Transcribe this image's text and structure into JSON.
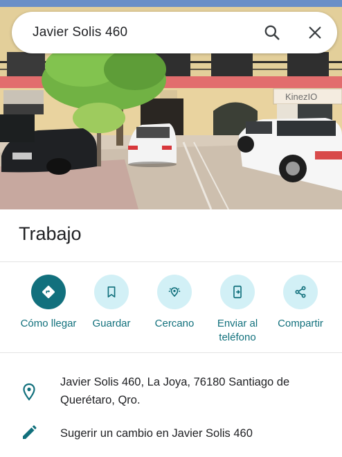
{
  "search": {
    "query": "Javier Solis 460"
  },
  "photo": {
    "sign_text": "KinezIO"
  },
  "place": {
    "title": "Trabajo"
  },
  "actions": [
    {
      "label": "Cómo llegar",
      "icon": "directions-icon",
      "primary": true
    },
    {
      "label": "Guardar",
      "icon": "bookmark-icon",
      "primary": false
    },
    {
      "label": "Cercano",
      "icon": "nearby-icon",
      "primary": false
    },
    {
      "label": "Enviar al teléfono",
      "icon": "send-to-phone-icon",
      "primary": false
    },
    {
      "label": "Compartir",
      "icon": "share-icon",
      "primary": false
    }
  ],
  "info": {
    "address": "Javier Solis 460, La Joya, 76180 Santiago de Querétaro, Qro.",
    "suggest_edit": "Sugerir un cambio en Javier Solis 460"
  },
  "colors": {
    "accent": "#11707c",
    "accent_light": "#d2f0f6",
    "text": "#202124",
    "divider": "#e3e3e3"
  }
}
